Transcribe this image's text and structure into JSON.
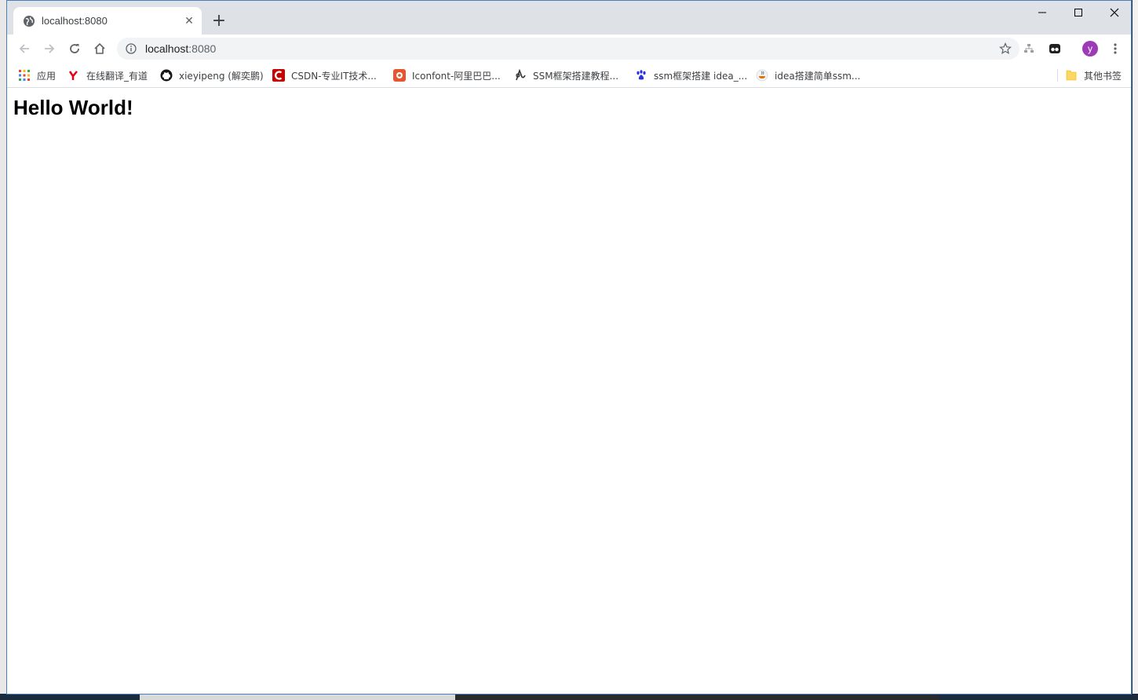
{
  "tab": {
    "title": "localhost:8080",
    "close_glyph": "✕",
    "new_tab_glyph": "+"
  },
  "omnibox": {
    "host": "localhost",
    "port": ":8080"
  },
  "profile": {
    "initial": "y",
    "color": "#9c3bb5"
  },
  "bookmarks": {
    "items": [
      {
        "label": "应用",
        "icon": "apps-grid-icon"
      },
      {
        "label": "在线翻译_有道",
        "icon": "youdao-icon"
      },
      {
        "label": "xieyipeng (解奕鹏)",
        "icon": "github-icon"
      },
      {
        "label": "CSDN-专业IT技术...",
        "icon": "csdn-icon"
      },
      {
        "label": "Iconfont-阿里巴巴...",
        "icon": "iconfont-icon"
      },
      {
        "label": "SSM框架搭建教程...",
        "icon": "ssm-site-icon"
      },
      {
        "label": "ssm框架搭建 idea_...",
        "icon": "baidu-paw-icon"
      },
      {
        "label": "idea搭建简单ssm...",
        "icon": "java-icon"
      }
    ],
    "other_label": "其他书签"
  },
  "page": {
    "heading": "Hello World!"
  },
  "colors": {
    "titlebar": "#dee1e6",
    "omnibox": "#f1f3f4",
    "window_border": "#4a7fb8"
  }
}
